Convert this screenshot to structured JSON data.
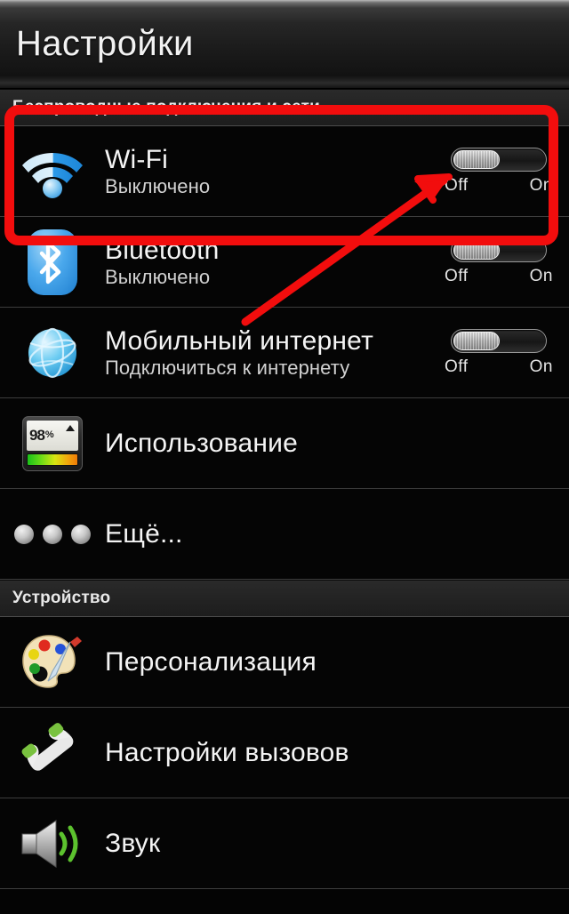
{
  "header": {
    "title": "Настройки"
  },
  "sections": [
    {
      "id": "wireless",
      "label": "Беспроводные подключения и сети"
    },
    {
      "id": "device",
      "label": "Устройство"
    }
  ],
  "toggle": {
    "off_label": "Off",
    "on_label": "On",
    "state": "off"
  },
  "rows": [
    {
      "id": "wifi",
      "icon": "wifi-icon",
      "title": "Wi-Fi",
      "subtitle": "Выключено",
      "has_toggle": true,
      "toggle_state": "off",
      "highlighted": true
    },
    {
      "id": "bluetooth",
      "icon": "bluetooth-icon",
      "title": "Bluetooth",
      "subtitle": "Выключено",
      "has_toggle": true,
      "toggle_state": "off",
      "highlighted": false
    },
    {
      "id": "mobile-internet",
      "icon": "globe-icon",
      "title": "Мобильный интернет",
      "subtitle": "Подключиться к интернету",
      "has_toggle": true,
      "toggle_state": "off",
      "highlighted": false
    },
    {
      "id": "usage",
      "icon": "usage-meter-icon",
      "title": "Использование",
      "subtitle": "",
      "has_toggle": false,
      "highlighted": false
    },
    {
      "id": "more",
      "icon": "more-dots-icon",
      "title": "Ещё...",
      "subtitle": "",
      "has_toggle": false,
      "highlighted": false
    },
    {
      "id": "personalization",
      "icon": "palette-icon",
      "title": "Персонализация",
      "subtitle": "",
      "has_toggle": false,
      "highlighted": false
    },
    {
      "id": "call-settings",
      "icon": "phone-handset-icon",
      "title": "Настройки вызовов",
      "subtitle": "",
      "has_toggle": false,
      "highlighted": false
    },
    {
      "id": "sound",
      "icon": "speaker-icon",
      "title": "Звук",
      "subtitle": "",
      "has_toggle": false,
      "highlighted": false
    }
  ],
  "usage_icon": {
    "value": "98",
    "unit": "%"
  },
  "annotations": {
    "highlight_color": "#f20d0d",
    "arrow_color": "#f20d0d",
    "highlight_target": "wifi",
    "arrow_target": "wifi-toggle"
  },
  "colors": {
    "background": "#040404",
    "row_text": "#f4f4f4",
    "sub_text": "#d2d2d2",
    "divider": "#3d3d3d",
    "accent_blue": "#4aa8ec",
    "accent_green": "#6abf3a",
    "annotation_red": "#f20d0d"
  }
}
